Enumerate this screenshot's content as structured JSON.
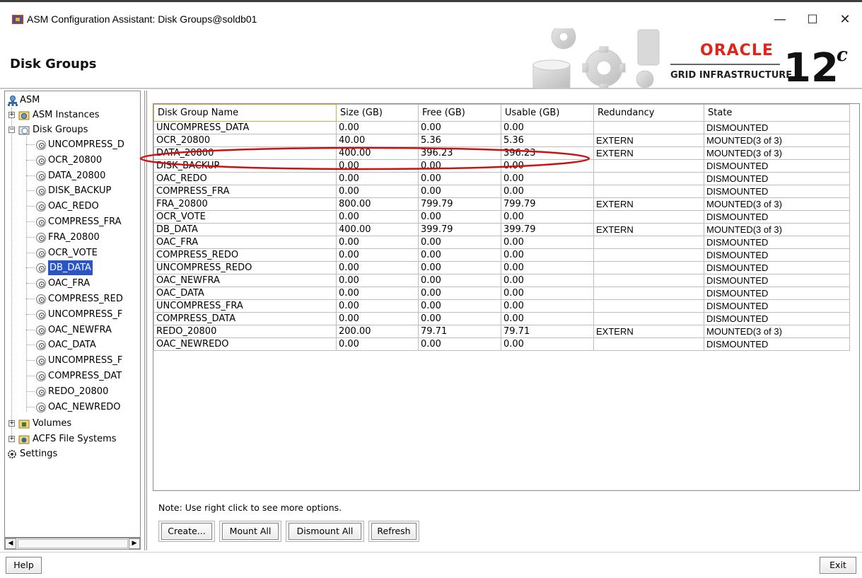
{
  "window": {
    "title": "ASM Configuration Assistant: Disk Groups@soldb01",
    "minimize_glyph": "—",
    "maximize_glyph": "☐",
    "close_glyph": "✕"
  },
  "header": {
    "title": "Disk Groups",
    "logo_brand": "ORACLE",
    "logo_sub": "GRID INFRASTRUCTURE",
    "logo_version": "12",
    "logo_version_suffix": "c"
  },
  "tree": {
    "root": "ASM",
    "asm_instances": "ASM Instances",
    "disk_groups": "Disk Groups",
    "items": [
      "UNCOMPRESS_D",
      "OCR_20800",
      "DATA_20800",
      "DISK_BACKUP",
      "OAC_REDO",
      "COMPRESS_FRA",
      "FRA_20800",
      "OCR_VOTE",
      "DB_DATA",
      "OAC_FRA",
      "COMPRESS_RED",
      "UNCOMPRESS_F",
      "OAC_NEWFRA",
      "OAC_DATA",
      "UNCOMPRESS_F",
      "COMPRESS_DAT",
      "REDO_20800",
      "OAC_NEWREDO"
    ],
    "selected_item": "DB_DATA",
    "volumes": "Volumes",
    "acfs": "ACFS File Systems",
    "settings": "Settings"
  },
  "table": {
    "columns": [
      "Disk Group Name",
      "Size (GB)",
      "Free (GB)",
      "Usable (GB)",
      "Redundancy",
      "State"
    ],
    "rows": [
      [
        "UNCOMPRESS_DATA",
        "0.00",
        "0.00",
        "0.00",
        "",
        "DISMOUNTED"
      ],
      [
        "OCR_20800",
        "40.00",
        "5.36",
        "5.36",
        "EXTERN",
        "MOUNTED(3 of 3)"
      ],
      [
        "DATA_20800",
        "400.00",
        "396.23",
        "396.23",
        "EXTERN",
        "MOUNTED(3 of 3)"
      ],
      [
        "DISK_BACKUP",
        "0.00",
        "0.00",
        "0.00",
        "",
        "DISMOUNTED"
      ],
      [
        "OAC_REDO",
        "0.00",
        "0.00",
        "0.00",
        "",
        "DISMOUNTED"
      ],
      [
        "COMPRESS_FRA",
        "0.00",
        "0.00",
        "0.00",
        "",
        "DISMOUNTED"
      ],
      [
        "FRA_20800",
        "800.00",
        "799.79",
        "799.79",
        "EXTERN",
        "MOUNTED(3 of 3)"
      ],
      [
        "OCR_VOTE",
        "0.00",
        "0.00",
        "0.00",
        "",
        "DISMOUNTED"
      ],
      [
        "DB_DATA",
        "400.00",
        "399.79",
        "399.79",
        "EXTERN",
        "MOUNTED(3 of 3)"
      ],
      [
        "OAC_FRA",
        "0.00",
        "0.00",
        "0.00",
        "",
        "DISMOUNTED"
      ],
      [
        "COMPRESS_REDO",
        "0.00",
        "0.00",
        "0.00",
        "",
        "DISMOUNTED"
      ],
      [
        "UNCOMPRESS_REDO",
        "0.00",
        "0.00",
        "0.00",
        "",
        "DISMOUNTED"
      ],
      [
        "OAC_NEWFRA",
        "0.00",
        "0.00",
        "0.00",
        "",
        "DISMOUNTED"
      ],
      [
        "OAC_DATA",
        "0.00",
        "0.00",
        "0.00",
        "",
        "DISMOUNTED"
      ],
      [
        "UNCOMPRESS_FRA",
        "0.00",
        "0.00",
        "0.00",
        "",
        "DISMOUNTED"
      ],
      [
        "COMPRESS_DATA",
        "0.00",
        "0.00",
        "0.00",
        "",
        "DISMOUNTED"
      ],
      [
        "REDO_20800",
        "200.00",
        "79.71",
        "79.71",
        "EXTERN",
        "MOUNTED(3 of 3)"
      ],
      [
        "OAC_NEWREDO",
        "0.00",
        "0.00",
        "0.00",
        "",
        "DISMOUNTED"
      ]
    ],
    "highlighted_row": "DATA_20800",
    "annotation_color": "#cc1111"
  },
  "footer": {
    "note": "Note: Use right click to see more options.",
    "create": "Create...",
    "mount_all": "Mount All",
    "dismount_all": "Dismount All",
    "refresh": "Refresh",
    "help": "Help",
    "exit": "Exit"
  },
  "colors": {
    "selection": "#2a55c6",
    "oracle_red": "#e0261b",
    "annotation": "#cc1111"
  }
}
